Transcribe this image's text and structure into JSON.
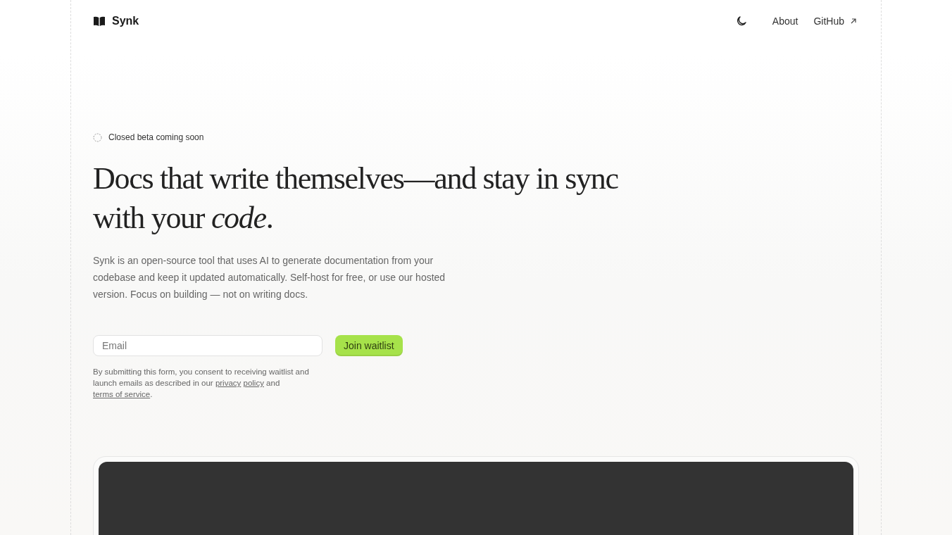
{
  "header": {
    "brand": "Synk",
    "nav": [
      {
        "label": "About",
        "external": false
      },
      {
        "label": "GitHub",
        "external": true
      }
    ]
  },
  "badge": {
    "label": "Closed beta coming soon"
  },
  "headline": "Docs that write themselves—and stay in sync with your *code*.",
  "description": "Synk is an open-source tool that uses AI to generate documentation from your codebase and keep it updated automatically. Self-host for free, or use our hosted version. Focus on building — not on writing docs.",
  "form": {
    "email": {
      "placeholder": "Email"
    },
    "button": "Join waitlist",
    "consent": [
      {
        "kind": "text",
        "text": "By submitting this form, you consent to receiving waitlist and launch emails as described in our "
      },
      {
        "kind": "link",
        "text": "privacy"
      },
      {
        "kind": "link",
        "text": "policy"
      },
      {
        "kind": "text",
        "text": " and "
      },
      {
        "kind": "link",
        "text": "terms of service"
      },
      {
        "kind": "text",
        "text": "."
      }
    ]
  }
}
